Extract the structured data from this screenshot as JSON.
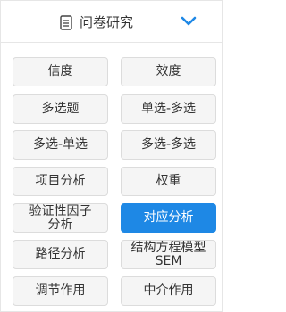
{
  "header": {
    "title": "问卷研究",
    "icon": "document-icon",
    "toggle_icon": "chevron-down-icon",
    "accent_color": "#1e88e5"
  },
  "buttons": [
    {
      "label": "信度"
    },
    {
      "label": "效度"
    },
    {
      "label": "多选题"
    },
    {
      "label": "单选-多选"
    },
    {
      "label": "多选-单选"
    },
    {
      "label": "多选-多选"
    },
    {
      "label": "项目分析"
    },
    {
      "label": "权重"
    },
    {
      "label": "验证性因子分析"
    },
    {
      "label": "对应分析",
      "active": true
    },
    {
      "label": "路径分析"
    },
    {
      "label": "结构方程模型SEM"
    },
    {
      "label": "调节作用"
    },
    {
      "label": "中介作用"
    }
  ]
}
